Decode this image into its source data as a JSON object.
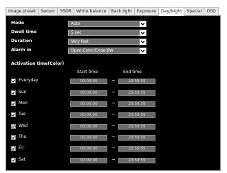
{
  "tabs": [
    {
      "label": "Image preset"
    },
    {
      "label": "Sensor"
    },
    {
      "label": "SSDR"
    },
    {
      "label": "White balance"
    },
    {
      "label": "Back light"
    },
    {
      "label": "Exposure"
    },
    {
      "label": "Day/Night",
      "active": true
    },
    {
      "label": "Special"
    },
    {
      "label": "OSD"
    }
  ],
  "settings": {
    "mode": {
      "label": "Mode",
      "value": "Auto"
    },
    "dwell": {
      "label": "Dwell time",
      "value": "5 sec"
    },
    "duration": {
      "label": "Duration",
      "value": "Very fast"
    },
    "alarm": {
      "label": "Alarm in",
      "value": "Open:Color/Close:BW"
    }
  },
  "activation": {
    "title": "Activation time(Color)",
    "start_header": "Start time",
    "end_header": "End time",
    "separator": "~",
    "rows": [
      {
        "day": "Everyday",
        "checked": true,
        "start": "00:00:00",
        "end": "23:59:59"
      },
      {
        "day": "Sun",
        "checked": true,
        "start": "00:00:00",
        "end": "23:59:59"
      },
      {
        "day": "Mon",
        "checked": true,
        "start": "00:00:00",
        "end": "23:59:59"
      },
      {
        "day": "Tue",
        "checked": true,
        "start": "00:00:00",
        "end": "23:59:59"
      },
      {
        "day": "Wed",
        "checked": true,
        "start": "00:00:00",
        "end": "23:59:59"
      },
      {
        "day": "Thu",
        "checked": true,
        "start": "00:00:00",
        "end": "23:59:59"
      },
      {
        "day": "Fri",
        "checked": true,
        "start": "00:00:00",
        "end": "23:59:59"
      },
      {
        "day": "Sat",
        "checked": true,
        "start": "00:00:00",
        "end": "23:59:59"
      }
    ]
  },
  "colors": {
    "panel_bg": "#000000",
    "field_bg": "#707070",
    "time_bg": "#6a6a6a",
    "tab_bg": "#e8e8e8"
  }
}
